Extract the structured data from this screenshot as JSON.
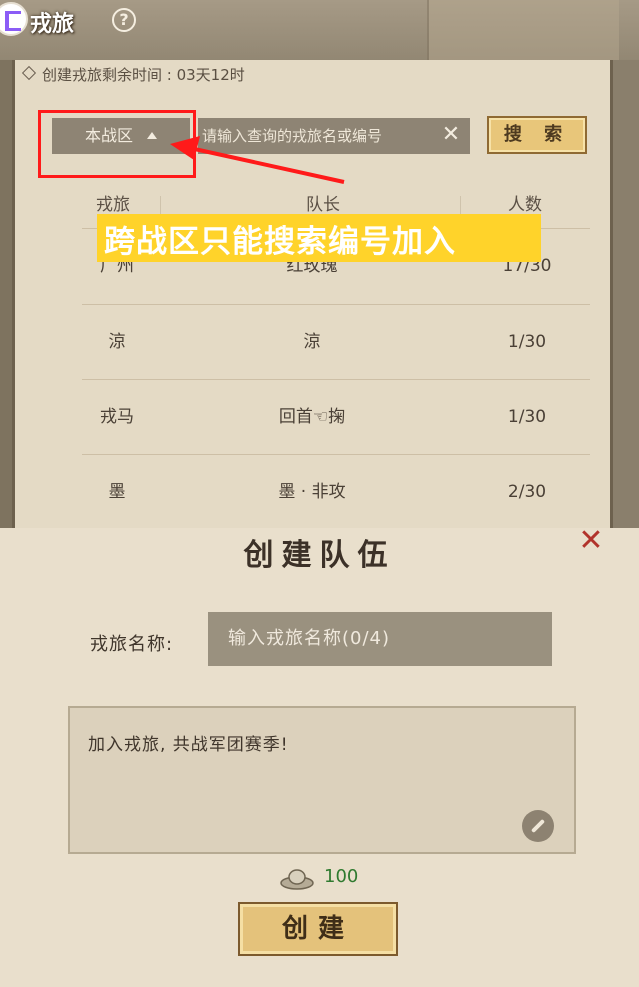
{
  "header": {
    "title": "戎旅",
    "help_glyph": "?"
  },
  "timer": {
    "text": "创建戎旅剩余时间 : 03天12时"
  },
  "search": {
    "zone_label": "本战区",
    "placeholder": "请输入查询的戎旅名或编号",
    "clear_glyph": "✕",
    "button_label": "搜 索"
  },
  "table": {
    "columns": [
      "戎旅",
      "队长",
      "人数"
    ],
    "rows": [
      {
        "name": "广州",
        "leader": "红玫瑰",
        "count": "17/30"
      },
      {
        "name": "涼",
        "leader": "涼",
        "count": "1/30"
      },
      {
        "name": "戎马",
        "leader": "回首☜掬",
        "count": "1/30"
      },
      {
        "name": "墨",
        "leader": "墨 · 非攻",
        "count": "2/30"
      }
    ]
  },
  "annotation": {
    "banner_text": "跨战区只能搜索编号加入",
    "banner_color": "#ffd32a",
    "highlight_color": "#ff1a1a"
  },
  "dialog": {
    "title": "创建队伍",
    "close_glyph": "✕",
    "name_label": "戎旅名称:",
    "name_placeholder": "输入戎旅名称(0/4)",
    "motto_text": "加入戎旅, 共战军团赛季!",
    "cost_value": "100",
    "create_label": "创建"
  },
  "icons": {
    "help": "help-icon",
    "clear": "close-icon",
    "edit": "edit-icon",
    "currency": "ingot-icon"
  }
}
